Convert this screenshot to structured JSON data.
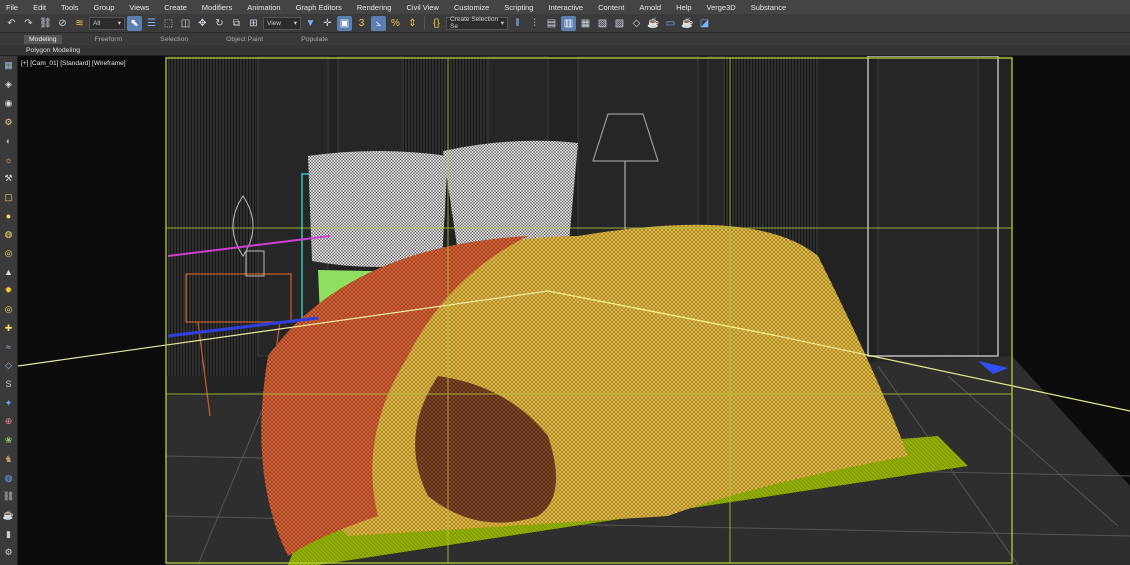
{
  "menu": [
    "File",
    "Edit",
    "Tools",
    "Group",
    "Views",
    "Create",
    "Modifiers",
    "Animation",
    "Graph Editors",
    "Rendering",
    "Civil View",
    "Customize",
    "Scripting",
    "Interactive",
    "Content",
    "Arnold",
    "Help",
    "Verge3D",
    "Substance"
  ],
  "toolbar": {
    "selection_filter": "All",
    "reference_coord": "View",
    "named_selection": "Create Selection Se"
  },
  "ribbon": {
    "tabs": [
      "Modeling",
      "Freeform",
      "Selection",
      "Object Paint",
      "Populate"
    ],
    "active_tab": "Modeling",
    "panel_label": "Polygon Modeling"
  },
  "viewport": {
    "label": "[+] [Cam_01] [Standard] [Wireframe]"
  },
  "colors": {
    "bedspread": "#f2d35a",
    "blanket": "#e8604a",
    "pillows": "#e6e6e6",
    "rug": "#9bb800",
    "camera_frame": "#b5cc3c",
    "mattress": "#8fe060",
    "headboard": "#35c8b0",
    "nightstand": "#c05a30",
    "active_button": "#5a7fb0"
  },
  "icons": {
    "main_toolbar": [
      "undo-icon",
      "redo-icon",
      "link-icon",
      "unlink-icon",
      "bind-spacewarp-icon",
      "select-icon",
      "select-by-name-icon",
      "rect-region-icon",
      "window-crossing-icon",
      "move-icon",
      "rotate-icon",
      "scale-icon",
      "select-manipulate-icon",
      "snap-3d-icon",
      "angle-snap-icon",
      "percent-snap-icon",
      "spinner-snap-icon",
      "edit-named-sets-icon",
      "mirror-icon",
      "align-icon",
      "scene-explorer-icon",
      "layer-explorer-icon",
      "graphite-toggle-icon",
      "curve-editor-icon",
      "schematic-view-icon",
      "material-editor-icon",
      "render-setup-icon",
      "render-frame-icon",
      "render-icon",
      "render-production-icon"
    ],
    "left_toolbar": [
      "viewport-layout-icon",
      "command-create-icon",
      "command-modify-icon",
      "command-hierarchy-icon",
      "command-motion-icon",
      "command-display-icon",
      "command-utilities-icon",
      "box-icon",
      "sphere-icon",
      "cylinder-icon",
      "torus-icon",
      "cone-icon",
      "light-icon",
      "camera-icon",
      "helper-icon",
      "spacewarp-icon",
      "systems-icon",
      "shape-icon",
      "particle-icon",
      "compound-icon",
      "foliage-icon",
      "character-icon",
      "globe-icon",
      "link-chain-icon",
      "render-icon",
      "bars-icon",
      "settings-icon"
    ]
  }
}
